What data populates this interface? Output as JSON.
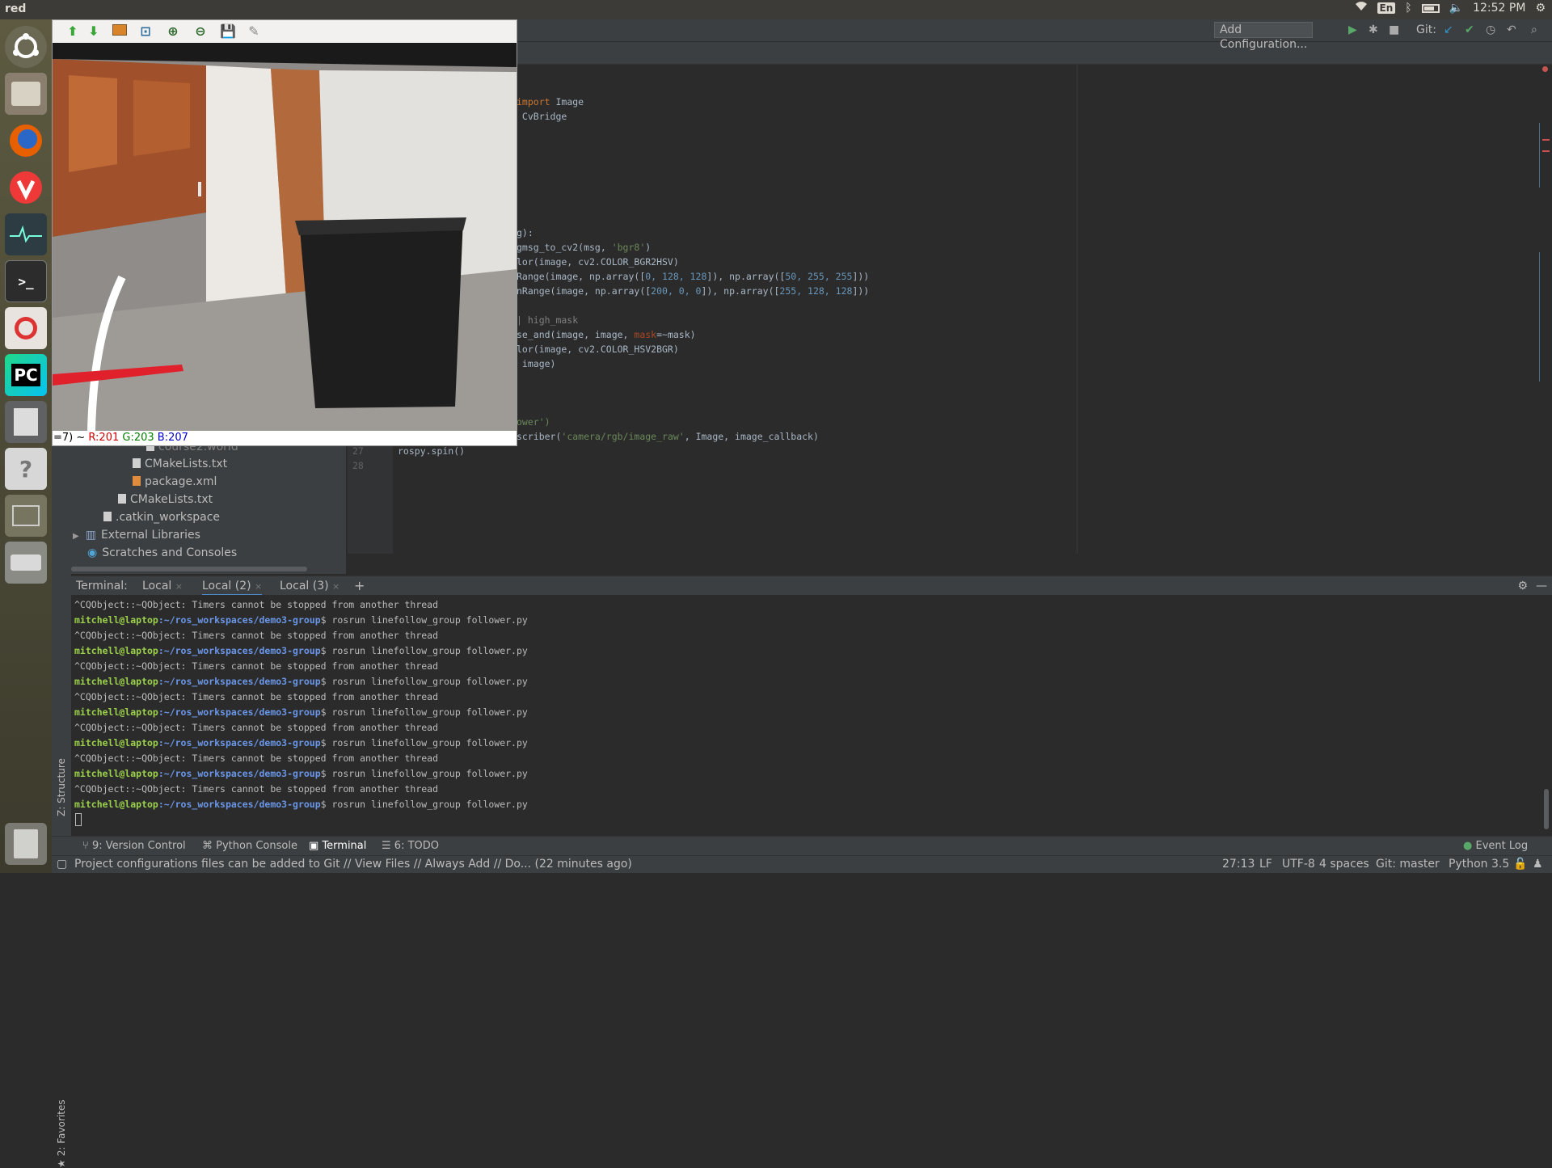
{
  "topbar": {
    "title": "red",
    "lang": "En",
    "time": "12:52 PM"
  },
  "image_window": {
    "pixel_readout_prefix": "=7) ~",
    "r": "R:201",
    "g": "G:203",
    "b": "B:207"
  },
  "ide": {
    "add_config": "Add Configuration...",
    "git_label": "Git:",
    "code_lines": {
      "l1_kw": "import",
      "l1": " Image",
      "l2": " CvBridge",
      "l3": "g):",
      "l4a": "gmsg_to_cv2(msg, ",
      "l4s": "'bgr8'",
      "l4b": ")",
      "l5": "lor(image, cv2.COLOR_BGR2HSV)",
      "l6a": "Range(image, np.array([",
      "l6n1": "0, 128, 128",
      "l6b": "]), np.array([",
      "l6n2": "50, 255, 255",
      "l6c": "]))",
      "l7a": "nRange(image, np.array([",
      "l7n1": "200, 0, 0",
      "l7b": "]), np.array([",
      "l7n2": "255, 128, 128",
      "l7c": "]))",
      "l8": "| high_mask",
      "l9a": "se_and(image, image, ",
      "l9p": "mask",
      "l9b": "=~mask)",
      "l10": "lor(image, cv2.COLOR_HSV2BGR)",
      "l11": " image)",
      "l12s": "ower')",
      "l13a": "scriber(",
      "l13s": "'camera/rgb/image_raw'",
      "l13b": ", Image, image_callback)",
      "l14": "rospy.spin()",
      "ln27": "27",
      "ln28": "28"
    }
  },
  "project_tree": {
    "items": [
      "course2.world",
      "CMakeLists.txt",
      "package.xml",
      "CMakeLists.txt",
      ".catkin_workspace",
      "External Libraries",
      "Scratches and Consoles"
    ]
  },
  "side_stripe": {
    "favorites": "2: Favorites",
    "structure": "Z: Structure"
  },
  "terminal": {
    "label": "Terminal:",
    "tabs": [
      "Local",
      "Local (2)",
      "Local (3)"
    ],
    "plus": "+",
    "warn": "^CQObject::~QObject: Timers cannot be stopped from another thread",
    "user": "mitchell@laptop",
    "path": ":~/ros_workspaces/demo3-group",
    "cmd": "$ rosrun linefollow_group follower.py"
  },
  "tool_tabs": {
    "version_control": "9: Version Control",
    "python_console": "Python Console",
    "terminal": "Terminal",
    "todo": "6: TODO",
    "event_log": "Event Log"
  },
  "status": {
    "message": "Project configurations files can be added to Git // View Files // Always Add // Do... (22 minutes ago)",
    "position": "27:13",
    "line_sep": "LF",
    "encoding": "UTF-8",
    "indent": "4 spaces",
    "git": "Git: master",
    "python": "Python 3.5"
  }
}
